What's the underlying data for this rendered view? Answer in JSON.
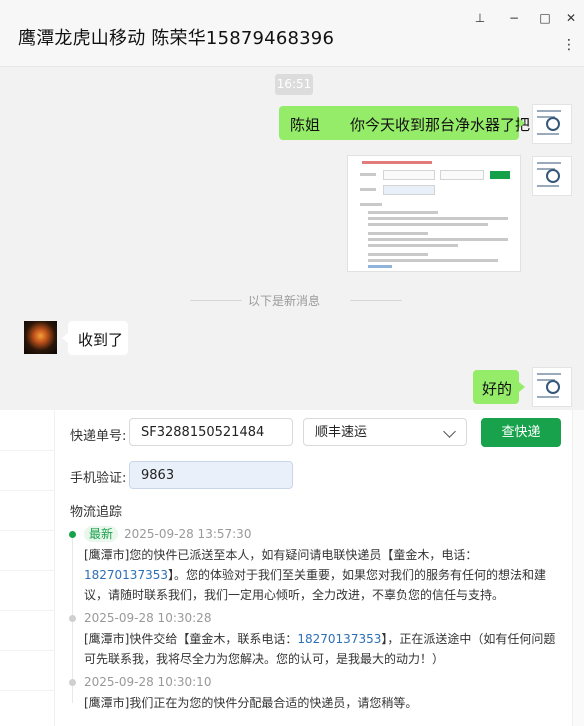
{
  "window": {
    "title": "鹰潭龙虎山移动 陈荣华15879468396",
    "controls": {
      "pin": "⊥",
      "minimize": "−",
      "maximize": "□",
      "close": "✕",
      "more": "⋮"
    }
  },
  "chat": {
    "time_stamp": "16:51",
    "messages": [
      {
        "sender": "me",
        "text": "陈姐　　你今天收到那台净水器了把"
      },
      {
        "sender": "me",
        "type": "image",
        "content_text": ""
      },
      {
        "sender": "other",
        "text": "收到了"
      },
      {
        "sender": "me",
        "text": "好的"
      }
    ],
    "new_messages_divider": "以下是新消息"
  },
  "query_panel": {
    "tracking_label": "快递单号:",
    "tracking_value": "SF3288150521484",
    "carrier_value": "顺丰速运",
    "query_button": "查快递",
    "verify_label": "手机验证:",
    "verify_value": "9863",
    "track_title": "物流追踪",
    "latest_badge": "最新",
    "events": [
      {
        "time": "2025-09-28 13:57:30",
        "text_before": "[鹰潭市]您的快件已派送至本人，如有疑问请电联快递员【童金木，电话：",
        "phone": "18270137353",
        "text_after": "】。您的体验对于我们至关重要，如果您对我们的服务有任何的想法和建议，请随时联系我们，我们一定用心倾听，全力改进，不辜负您的信任与支持。"
      },
      {
        "time": "2025-09-28 10:30:28",
        "text_before": "[鹰潭市]快件交给【童金木，联系电话：",
        "phone": "18270137353",
        "text_after": "】，正在派送途中（如有任何问题可先联系我，我将尽全力为您解决。您的认可，是我最大的动力！）"
      },
      {
        "time": "2025-09-28 10:30:10",
        "text_before": "[鹰潭市]我们正在为您的快件分配最合适的快递员，请您稍等。",
        "phone": "",
        "text_after": ""
      }
    ]
  },
  "colors": {
    "accent_green": "#17a24b",
    "bubble_green": "#95ec69",
    "link_blue": "#2d6fb7"
  }
}
